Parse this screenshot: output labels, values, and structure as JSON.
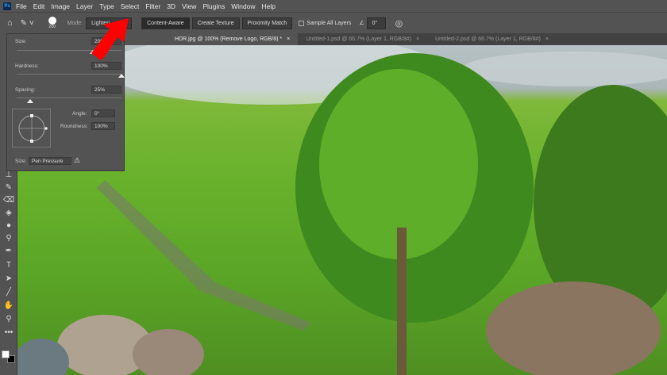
{
  "menu": {
    "logo": "Ps",
    "items": [
      "File",
      "Edit",
      "Image",
      "Layer",
      "Type",
      "Select",
      "Filter",
      "3D",
      "View",
      "Plugins",
      "Window",
      "Help"
    ]
  },
  "options": {
    "brush_size": "200",
    "mode_label": "Mode:",
    "mode_value": "Lighten",
    "buttons": [
      "Content-Aware",
      "Create Texture",
      "Proximity Match"
    ],
    "sample_all_layers": "Sample All Layers",
    "angle": "0°"
  },
  "tabs": [
    {
      "label": "HDR.jpg @ 100% (Remove Logo, RGB/8) *",
      "active": true
    },
    {
      "label": "Untitled-1.psd @ 66.7% (Layer 1, RGB/8#)",
      "active": false
    },
    {
      "label": "Untitled-2.psd @ 66.7% (Layer 1, RGB/8#)",
      "active": false
    }
  ],
  "brush_panel": {
    "size_label": "Size:",
    "size_value": "200",
    "size_fraction": 0.73,
    "hardness_label": "Hardness:",
    "hardness_value": "100%",
    "hardness_fraction": 1.0,
    "spacing_label": "Spacing:",
    "spacing_value": "25%",
    "spacing_fraction": 0.13,
    "angle_label": "Angle:",
    "angle_value": "0°",
    "roundness_label": "Roundness:",
    "roundness_value": "100%",
    "size_control_label": "Size:",
    "size_control_value": "Pen Pressure"
  },
  "colors": {
    "arrow": "#ff0000"
  }
}
